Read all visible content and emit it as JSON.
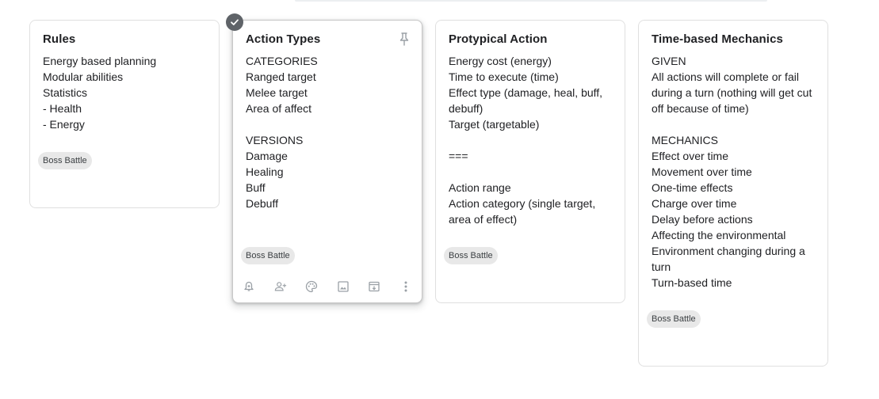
{
  "cards": [
    {
      "title": "Rules",
      "lines": [
        "Energy based planning",
        "Modular abilities",
        "Statistics",
        "- Health",
        "- Energy"
      ],
      "label": "Boss Battle"
    },
    {
      "title": "Action Types",
      "lines": [
        "CATEGORIES",
        "Ranged target",
        "Melee target",
        "Area of affect",
        "",
        "VERSIONS",
        "Damage",
        "Healing",
        "Buff",
        "Debuff"
      ],
      "label": "Boss Battle"
    },
    {
      "title": "Protypical Action",
      "lines": [
        "Energy cost (energy)",
        "Time to execute (time)",
        "Effect type (damage, heal, buff, debuff)",
        "Target (targetable)",
        "",
        "===",
        "",
        "Action range",
        "Action category (single target, area of effect)"
      ],
      "label": "Boss Battle"
    },
    {
      "title": "Time-based Mechanics",
      "lines": [
        "GIVEN",
        "All actions will complete or fail during a turn (nothing will get cut off because of time)",
        "",
        "MECHANICS",
        "Effect over time",
        "Movement over time",
        "One-time effects",
        "Charge over time",
        "Delay before actions",
        "Affecting the environmental",
        "Environment changing during a turn",
        "Turn-based time"
      ],
      "label": "Boss Battle"
    }
  ],
  "toolbar_icons": [
    "remind-me-icon",
    "collaborator-icon",
    "background-options-icon",
    "add-image-icon",
    "archive-icon",
    "more-options-icon"
  ],
  "colors": {
    "icon_gray": "#5f6368",
    "label_bg": "#e8e8e8",
    "card_border": "#e0e0e0"
  }
}
